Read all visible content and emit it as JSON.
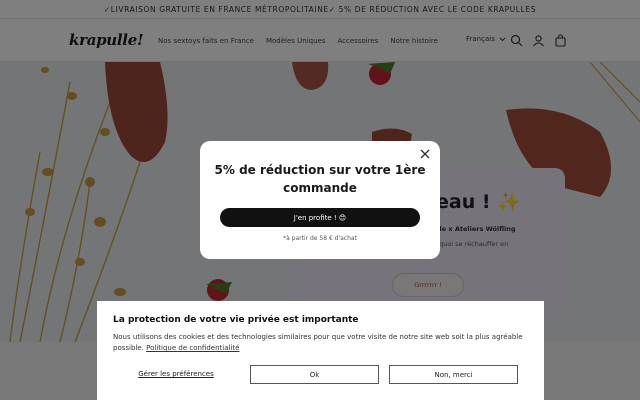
{
  "announcement": "✓LIVRAISON GRATUITE EN FRANCE MÉTROPOLITAINE✓ 5% DE RÉDUCTION AVEC LE CODE KRAPULLES",
  "header": {
    "logo": "krapulle!",
    "nav": [
      "Nos sextoys faits en France",
      "Modèles Uniques",
      "Accessoires",
      "Notre histoire"
    ],
    "language": "Français"
  },
  "promo_panel": {
    "headline": "eau ! ✨",
    "subtitle": "pulle x Ateliers Wölfling",
    "line2": "De quoi se réchauffer en",
    "button": "Grrrrrrr !"
  },
  "modal": {
    "title": "5% de réduction sur votre 1ère commande",
    "cta": "J'en profite ! 😊",
    "note": "*à partir de 58 € d'achat"
  },
  "cookie": {
    "title": "La protection de votre vie privée est importante",
    "text": "Nous utilisons des cookies et des technologies similaires pour que votre visite de notre site web soit la plus agréable possible.",
    "link": "Politique de confidentialité",
    "preferences": "Gérer les préférences",
    "ok": "Ok",
    "decline": "Non, merci"
  },
  "colors": {
    "overlay": "#000000",
    "promo_bg": "#ece6f7",
    "cta_bg": "#111111"
  }
}
